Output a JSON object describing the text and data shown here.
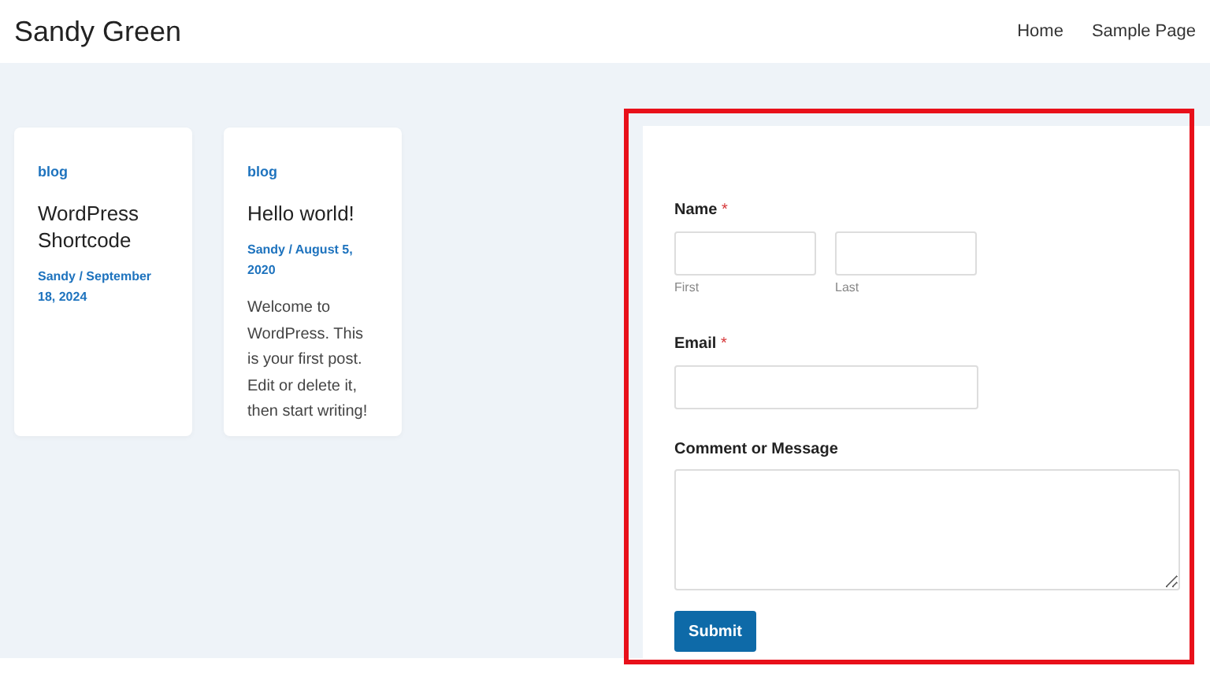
{
  "site": {
    "title": "Sandy Green"
  },
  "nav": [
    {
      "label": "Home"
    },
    {
      "label": "Sample Page"
    }
  ],
  "posts": [
    {
      "category": "blog",
      "title": "WordPress Shortcode",
      "meta": "Sandy / September 18, 2024"
    },
    {
      "category": "blog",
      "title": "Hello world!",
      "meta": "Sandy / August 5, 2020",
      "excerpt": "Welcome to WordPress. This is your first post. Edit or delete it, then start writing!"
    }
  ],
  "form": {
    "name": {
      "label": "Name",
      "required_mark": "*",
      "sublabels": [
        "First",
        "Last"
      ]
    },
    "email": {
      "label": "Email",
      "required_mark": "*"
    },
    "message": {
      "label": "Comment or Message"
    },
    "submit": "Submit"
  },
  "highlight": {
    "visible": true
  }
}
